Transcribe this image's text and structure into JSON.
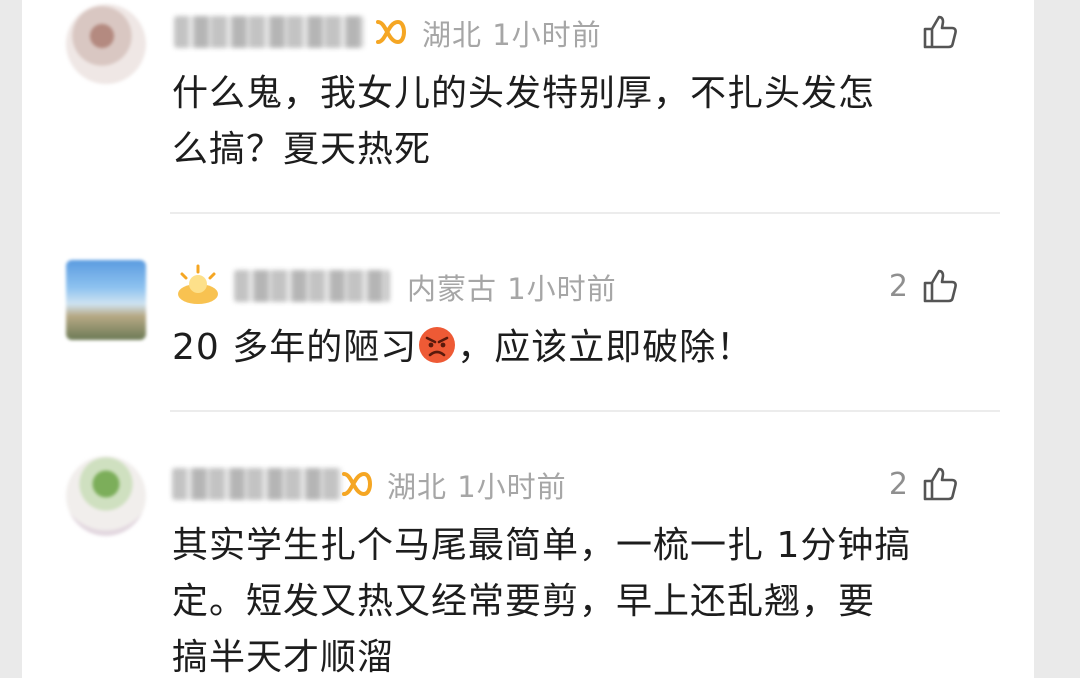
{
  "comments": [
    {
      "location": "湖北",
      "time": "1小时前",
      "likes": "",
      "text_lines": [
        "什么鬼，我女儿的头发特别厚，不扎头发怎",
        "么搞？夏天热死"
      ],
      "badge_icon": "vip-badge-icon"
    },
    {
      "location": "内蒙古",
      "time": "1小时前",
      "likes": "2",
      "text_before": "20 多年的陋习",
      "text_after": "，应该立即破除！",
      "emoji_icon": "angry-face-emoji",
      "badge_icon": "sun-badge-icon"
    },
    {
      "location": "湖北",
      "time": "1小时前",
      "likes": "2",
      "text_lines": [
        "其实学生扎个马尾最简单，一梳一扎 1分钟搞",
        "定。短发又热又经常要剪，早上还乱翘，要",
        "搞半天才顺溜"
      ],
      "badge_icon": "vip-badge-icon"
    }
  ],
  "colors": {
    "meta_text": "#a6a6a6",
    "body_text": "#1d1d1d",
    "vip_badge": "#f5a623",
    "like_icon": "#555555"
  }
}
